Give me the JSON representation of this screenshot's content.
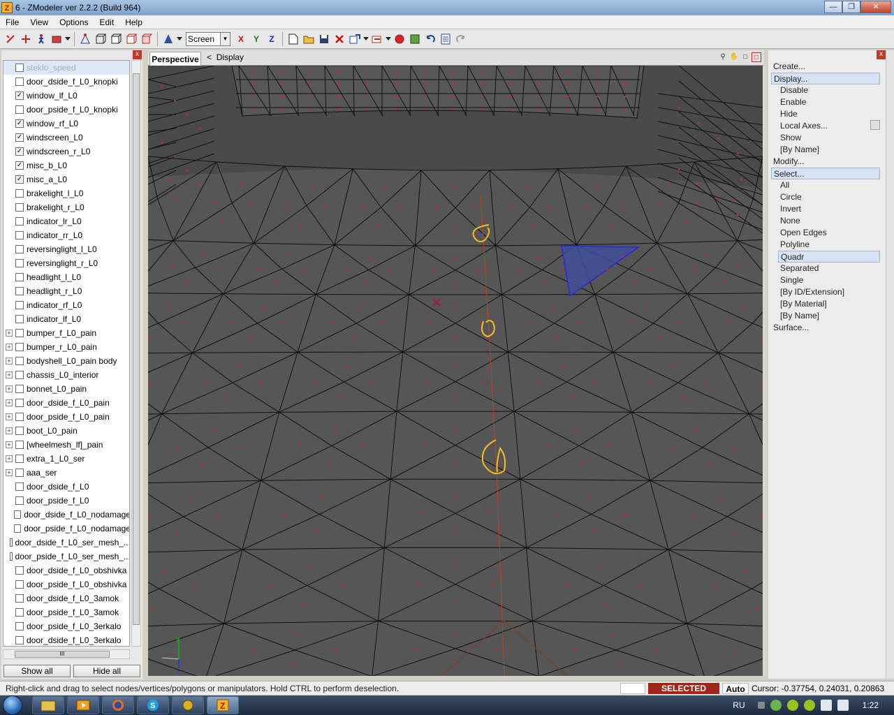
{
  "window": {
    "title": "6 - ZModeler ver 2.2.2 (Build 964)",
    "min": "—",
    "max": "❐",
    "close": "✕",
    "app_icon": "Z"
  },
  "menu": [
    "File",
    "View",
    "Options",
    "Edit",
    "Help"
  ],
  "toolbar": {
    "space_select": "Screen",
    "axis_x": "X",
    "axis_y": "Y",
    "axis_z": "Z"
  },
  "left_panel": {
    "close": "x",
    "items": [
      {
        "label": "steklo_speed",
        "checked": false,
        "expand": false,
        "highlighted": true
      },
      {
        "label": "door_dside_f_L0_knopki",
        "checked": false,
        "expand": false
      },
      {
        "label": "window_lf_L0",
        "checked": true,
        "expand": false
      },
      {
        "label": "door_pside_f_L0_knopki",
        "checked": false,
        "expand": false
      },
      {
        "label": "window_rf_L0",
        "checked": true,
        "expand": false
      },
      {
        "label": "windscreen_L0",
        "checked": true,
        "expand": false
      },
      {
        "label": "windscreen_r_L0",
        "checked": true,
        "expand": false
      },
      {
        "label": "misc_b_L0",
        "checked": true,
        "expand": false
      },
      {
        "label": "misc_a_L0",
        "checked": true,
        "expand": false
      },
      {
        "label": "brakelight_l_L0",
        "checked": false,
        "expand": false
      },
      {
        "label": "brakelight_r_L0",
        "checked": false,
        "expand": false
      },
      {
        "label": "indicator_lr_L0",
        "checked": false,
        "expand": false
      },
      {
        "label": "indicator_rr_L0",
        "checked": false,
        "expand": false
      },
      {
        "label": "reversinglight_l_L0",
        "checked": false,
        "expand": false
      },
      {
        "label": "reversinglight_r_L0",
        "checked": false,
        "expand": false
      },
      {
        "label": "headlight_l_L0",
        "checked": false,
        "expand": false
      },
      {
        "label": "headlight_r_L0",
        "checked": false,
        "expand": false
      },
      {
        "label": "indicator_rf_L0",
        "checked": false,
        "expand": false
      },
      {
        "label": "indicator_lf_L0",
        "checked": false,
        "expand": false
      },
      {
        "label": "bumper_f_L0_pain",
        "checked": false,
        "expand": true
      },
      {
        "label": "bumper_r_L0_pain",
        "checked": false,
        "expand": true
      },
      {
        "label": "bodyshell_L0_pain body",
        "checked": false,
        "expand": true
      },
      {
        "label": "chassis_L0_interior",
        "checked": false,
        "expand": true
      },
      {
        "label": "bonnet_L0_pain",
        "checked": false,
        "expand": true
      },
      {
        "label": "door_dside_f_L0_pain",
        "checked": false,
        "expand": true
      },
      {
        "label": "door_pside_f_L0_pain",
        "checked": false,
        "expand": true
      },
      {
        "label": "boot_L0_pain",
        "checked": false,
        "expand": true
      },
      {
        "label": "[wheelmesh_lf]_pain",
        "checked": false,
        "expand": true
      },
      {
        "label": "extra_1_L0_ser",
        "checked": false,
        "expand": true
      },
      {
        "label": "aaa_ser",
        "checked": false,
        "expand": true
      },
      {
        "label": "door_dside_f_L0",
        "checked": false,
        "expand": false
      },
      {
        "label": "door_pside_f_L0",
        "checked": false,
        "expand": false
      },
      {
        "label": "door_dside_f_L0_nodamage",
        "checked": false,
        "expand": false
      },
      {
        "label": "door_pside_f_L0_nodamage",
        "checked": false,
        "expand": false
      },
      {
        "label": "door_dside_f_L0_ser_mesh_...",
        "checked": false,
        "expand": false
      },
      {
        "label": "door_pside_f_L0_ser_mesh_...",
        "checked": false,
        "expand": false
      },
      {
        "label": "door_dside_f_L0_obshivka",
        "checked": false,
        "expand": false
      },
      {
        "label": "door_pside_f_L0_obshivka",
        "checked": false,
        "expand": false
      },
      {
        "label": "door_dside_f_L0_3amok",
        "checked": false,
        "expand": false
      },
      {
        "label": "door_pside_f_L0_3amok",
        "checked": false,
        "expand": false
      },
      {
        "label": "door_pside_f_L0_3erkalo",
        "checked": false,
        "expand": false
      },
      {
        "label": "door_dside_f_L0_3erkalo",
        "checked": false,
        "expand": false
      }
    ],
    "show_all": "Show all",
    "hide_all": "Hide all",
    "hscroll_grip": "III"
  },
  "viewport": {
    "tab": "Perspective",
    "back": "<",
    "breadcrumb": "Display",
    "axis_y": "y",
    "axis_z": "z"
  },
  "right_panel": {
    "close": "x",
    "items": [
      {
        "label": "Create...",
        "indent": 0,
        "hl": false
      },
      {
        "label": "Display...",
        "indent": 0,
        "hl": true
      },
      {
        "label": "Disable",
        "indent": 1,
        "hl": false
      },
      {
        "label": "Enable",
        "indent": 1,
        "hl": false
      },
      {
        "label": "Hide",
        "indent": 1,
        "hl": false
      },
      {
        "label": "Local Axes...",
        "indent": 1,
        "hl": false
      },
      {
        "label": "Show",
        "indent": 1,
        "hl": false
      },
      {
        "label": "[By Name]",
        "indent": 1,
        "hl": false
      },
      {
        "label": "Modify...",
        "indent": 0,
        "hl": false
      },
      {
        "label": "Select...",
        "indent": 0,
        "hl": true
      },
      {
        "label": "All",
        "indent": 1,
        "hl": false
      },
      {
        "label": "Circle",
        "indent": 1,
        "hl": false
      },
      {
        "label": "Invert",
        "indent": 1,
        "hl": false
      },
      {
        "label": "None",
        "indent": 1,
        "hl": false
      },
      {
        "label": "Open Edges",
        "indent": 1,
        "hl": false
      },
      {
        "label": "Polyline",
        "indent": 1,
        "hl": false
      },
      {
        "label": "Quadr",
        "indent": 1,
        "hl": true
      },
      {
        "label": "Separated",
        "indent": 1,
        "hl": false
      },
      {
        "label": "Single",
        "indent": 1,
        "hl": false
      },
      {
        "label": "[By ID/Extension]",
        "indent": 1,
        "hl": false
      },
      {
        "label": "[By Material]",
        "indent": 1,
        "hl": false
      },
      {
        "label": "[By Name]",
        "indent": 1,
        "hl": false
      },
      {
        "label": "Surface...",
        "indent": 0,
        "hl": false
      }
    ]
  },
  "status": {
    "hint": "Right-click and drag to select nodes/vertices/polygons or manipulators. Hold CTRL to perform deselection.",
    "mode": "SELECTED MODE",
    "auto": "Auto",
    "cursor": "Cursor: -0.37754, 0.24031, 0.20863"
  },
  "taskbar": {
    "lang": "RU",
    "time": "1:22",
    "apps": [
      "explorer",
      "media",
      "firefox",
      "skype",
      "app",
      "zmodeler"
    ]
  },
  "colors": {
    "vertex": "#e02020",
    "selection": "#2a2ad8",
    "annotation": "#f0c020",
    "mode_badge": "#a0261a",
    "viewport_bg": "#4a4a4a"
  }
}
